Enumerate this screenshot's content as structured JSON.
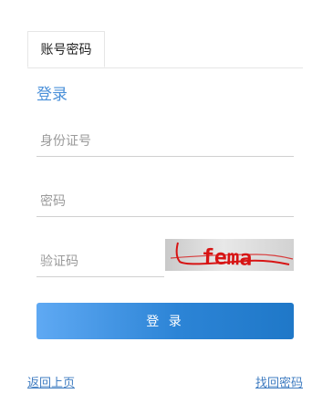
{
  "tabs": [
    {
      "label": "账号密码"
    }
  ],
  "form": {
    "title": "登录",
    "id_placeholder": "身份证号",
    "password_placeholder": "密码",
    "captcha_placeholder": "验证码",
    "captcha_text": "fema",
    "submit_label": "登 录"
  },
  "links": {
    "back": "返回上页",
    "forgot": "找回密码"
  },
  "colors": {
    "accent": "#4a90d9",
    "button_start": "#5fa9f3",
    "button_end": "#1f78c8",
    "captcha_text": "#d71414"
  }
}
